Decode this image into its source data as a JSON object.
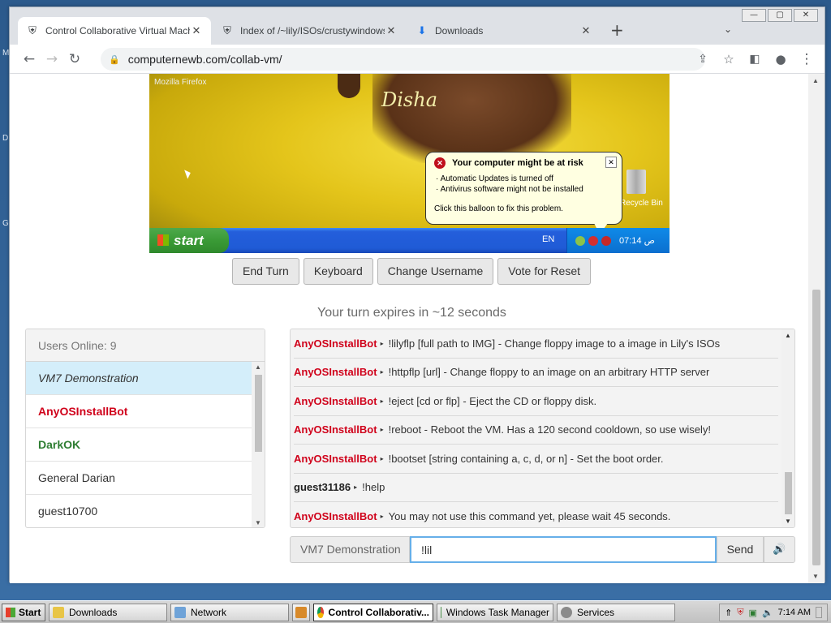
{
  "browser": {
    "tabs": [
      {
        "title": "Control Collaborative Virtual Machin",
        "active": true
      },
      {
        "title": "Index of /~lily/ISOs/crustywindows/",
        "active": false
      },
      {
        "title": "Downloads",
        "active": false
      }
    ],
    "url": "computernewb.com/collab-vm/"
  },
  "vm": {
    "screen": {
      "firefox_label": "Mozilla Firefox",
      "wallpaper_title": "Disha",
      "recycle_bin": "Recycle Bin",
      "balloon": {
        "title": "Your computer might be at risk",
        "lines": [
          "Automatic Updates is turned off",
          "Antivirus software might not be installed"
        ],
        "footer": "Click this balloon to fix this problem."
      },
      "start_label": "start",
      "lang": "EN",
      "clock": "07:14 ص"
    },
    "controls": [
      "End Turn",
      "Keyboard",
      "Change Username",
      "Vote for Reset"
    ],
    "turn_text": "Your turn expires in ~12 seconds"
  },
  "users": {
    "header": "Users Online: 9",
    "list": [
      {
        "name": "VM7 Demonstration",
        "style": "selected"
      },
      {
        "name": "AnyOSInstallBot",
        "style": "red"
      },
      {
        "name": "DarkOK",
        "style": "green"
      },
      {
        "name": "General Darian",
        "style": "normal"
      },
      {
        "name": "guest10700",
        "style": "normal"
      }
    ]
  },
  "chat": {
    "messages": [
      {
        "user": "AnyOSInstallBot",
        "text": "!lilyflp [full path to IMG] - Change floppy image to a image in Lily's ISOs",
        "color": "red"
      },
      {
        "user": "AnyOSInstallBot",
        "text": "!httpflp [url] - Change floppy to an image on an arbitrary HTTP server",
        "color": "red"
      },
      {
        "user": "AnyOSInstallBot",
        "text": "!eject [cd or flp] - Eject the CD or floppy disk.",
        "color": "red"
      },
      {
        "user": "AnyOSInstallBot",
        "text": "!reboot - Reboot the VM. Has a 120 second cooldown, so use wisely!",
        "color": "red"
      },
      {
        "user": "AnyOSInstallBot",
        "text": "!bootset [string containing a, c, d, or n] - Set the boot order.",
        "color": "red"
      },
      {
        "user": "guest31186",
        "text": "!help",
        "color": "dark"
      },
      {
        "user": "AnyOSInstallBot",
        "text": "You may not use this command yet, please wait 45 seconds.",
        "color": "red"
      }
    ],
    "username": "VM7 Demonstration",
    "input_value": "!lil",
    "send_label": "Send"
  },
  "os_taskbar": {
    "start": "Start",
    "tasks": [
      "Downloads",
      "Network",
      "Control Collaborativ...",
      "Windows Task Manager",
      "Services"
    ],
    "clock": "7:14 AM"
  },
  "desktop_letters": [
    "M",
    "D",
    "G"
  ]
}
